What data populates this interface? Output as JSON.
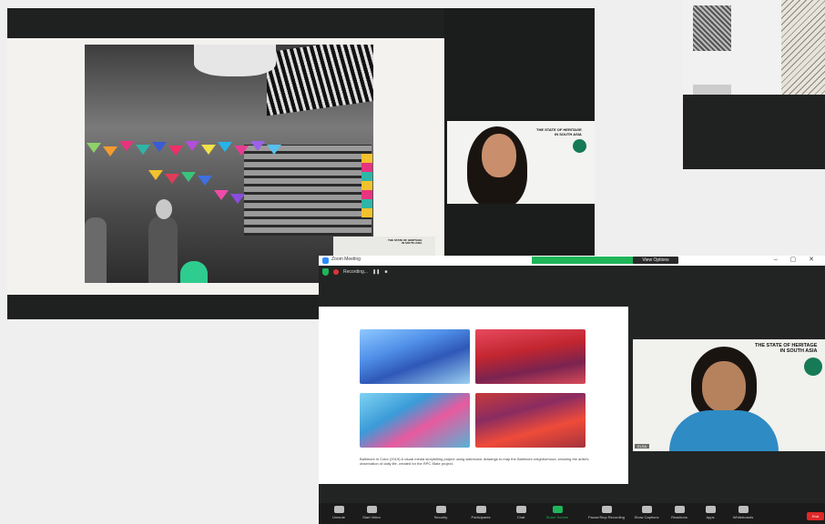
{
  "zoom": {
    "window_title": "Zoom Meeting",
    "notification": "",
    "view_options": "View Options",
    "recording": "Recording...",
    "cam_name": "ELSA",
    "slide_caption": "Baltimore in Color (2019) A visual media storytelling project using watercolor drawings to map the Baltimore neighborhood, showing the artist's observation of daily life, created for the RPC State project.",
    "end_label": "End",
    "heritage_title_line1": "THE STATE OF HERITAGE",
    "heritage_title_line2": "IN SOUTH ASIA",
    "toolbar": [
      {
        "label": "Unmute"
      },
      {
        "label": "Start Video"
      },
      {
        "label": "Security"
      },
      {
        "label": "Participants"
      },
      {
        "label": "Chat"
      },
      {
        "label": "Share Screen"
      },
      {
        "label": "Pause/Stop Recording"
      },
      {
        "label": "Show Captions"
      },
      {
        "label": "Reactions"
      },
      {
        "label": "Apps"
      },
      {
        "label": "Whiteboards"
      }
    ]
  },
  "shot1": {
    "heritage_line1": "THE STATE OF HERITAGE",
    "heritage_line2": "IN SOUTH ASIA"
  },
  "colors": {
    "zoom_green": "#1fb559",
    "heritage_green": "#157a55",
    "end_red": "#e02828"
  }
}
